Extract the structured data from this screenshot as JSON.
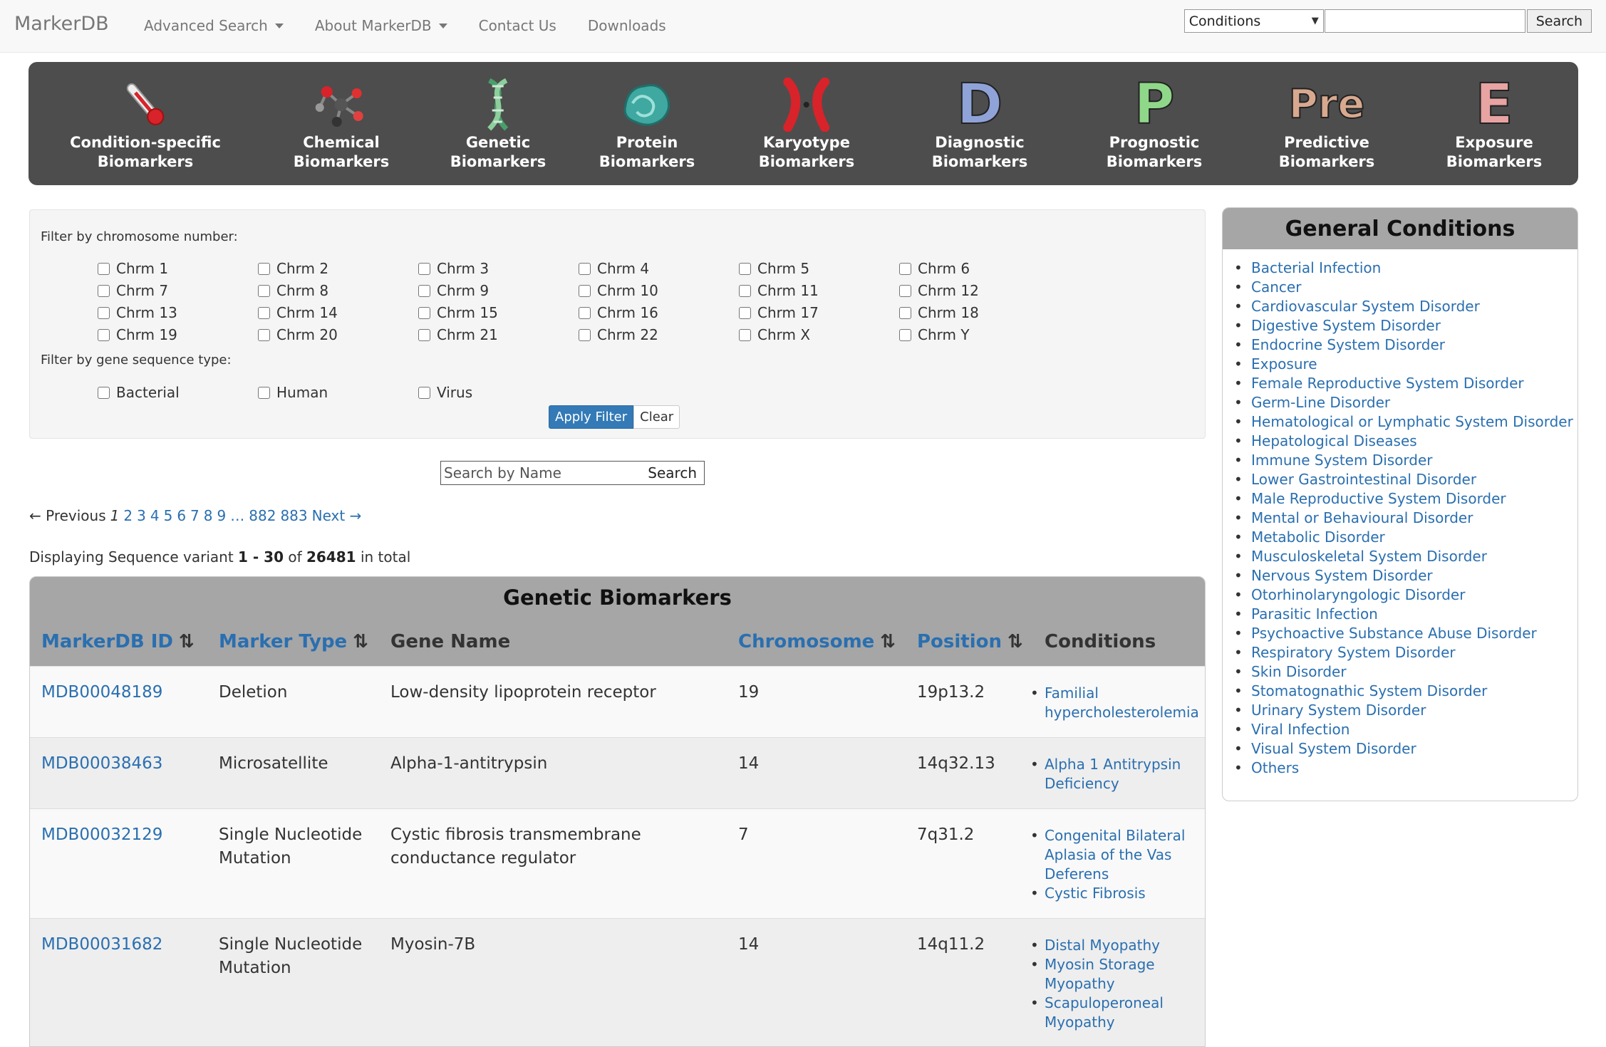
{
  "navbar": {
    "brand": "MarkerDB",
    "links": [
      "Advanced Search",
      "About MarkerDB",
      "Contact Us",
      "Downloads"
    ],
    "search_select": "Conditions",
    "search_button": "Search"
  },
  "banner": {
    "items": [
      {
        "line1": "Condition-specific",
        "line2": "Biomarkers",
        "icon": "thermometer-icon"
      },
      {
        "line1": "Chemical",
        "line2": "Biomarkers",
        "icon": "molecule-icon"
      },
      {
        "line1": "Genetic",
        "line2": "Biomarkers",
        "icon": "dna-icon"
      },
      {
        "line1": "Protein",
        "line2": "Biomarkers",
        "icon": "protein-icon"
      },
      {
        "line1": "Karyotype",
        "line2": "Biomarkers",
        "icon": "chromosome-icon"
      },
      {
        "line1": "Diagnostic",
        "line2": "Biomarkers",
        "icon": "letter-d-icon",
        "letter": "D"
      },
      {
        "line1": "Prognostic",
        "line2": "Biomarkers",
        "icon": "letter-p-icon",
        "letter": "P"
      },
      {
        "line1": "Predictive",
        "line2": "Biomarkers",
        "icon": "letter-pre-icon",
        "letter": "Pre"
      },
      {
        "line1": "Exposure",
        "line2": "Biomarkers",
        "icon": "letter-e-icon",
        "letter": "E"
      }
    ],
    "colors": {
      "diagnostic": "#8fa3d8",
      "prognostic": "#8fd889",
      "predictive": "#d8a98f",
      "exposure": "#e8a3a3"
    }
  },
  "filter": {
    "chromosome_label": "Filter by chromosome number:",
    "chromosomes": [
      "Chrm 1",
      "Chrm 2",
      "Chrm 3",
      "Chrm 4",
      "Chrm 5",
      "Chrm 6",
      "Chrm 7",
      "Chrm 8",
      "Chrm 9",
      "Chrm 10",
      "Chrm 11",
      "Chrm 12",
      "Chrm 13",
      "Chrm 14",
      "Chrm 15",
      "Chrm 16",
      "Chrm 17",
      "Chrm 18",
      "Chrm 19",
      "Chrm 20",
      "Chrm 21",
      "Chrm 22",
      "Chrm X",
      "Chrm Y"
    ],
    "sequence_label": "Filter by gene sequence type:",
    "sequence_types": [
      "Bacterial",
      "Human",
      "Virus"
    ],
    "apply_label": "Apply Filter",
    "clear_label": "Clear"
  },
  "search_by_name": {
    "placeholder": "Search by Name",
    "button": "Search"
  },
  "pagination": {
    "previous": "← Previous",
    "current": "1",
    "pages": [
      "2",
      "3",
      "4",
      "5",
      "6",
      "7",
      "8",
      "9"
    ],
    "ellipsis": "…",
    "last_pages": [
      "882",
      "883"
    ],
    "next": "Next →"
  },
  "display": {
    "prefix": "Displaying Sequence variant ",
    "range": "1 - 30",
    "of": " of ",
    "total": "26481",
    "suffix": " in total"
  },
  "table": {
    "title": "Genetic Biomarkers",
    "headers": [
      "MarkerDB ID",
      "Marker Type",
      "Gene Name",
      "Chromosome",
      "Position",
      "Conditions"
    ],
    "sort_icon": "⇅",
    "rows": [
      {
        "id": "MDB00048189",
        "type": [
          "Deletion"
        ],
        "gene": [
          "Low-density lipoprotein receptor"
        ],
        "chrom": "19",
        "pos": "19p13.2",
        "conditions": [
          [
            "Familial",
            "hypercholesterolemia"
          ]
        ]
      },
      {
        "id": "MDB00038463",
        "type": [
          "Microsatellite"
        ],
        "gene": [
          "Alpha-1-antitrypsin"
        ],
        "chrom": "14",
        "pos": "14q32.13",
        "conditions": [
          [
            "Alpha 1 Antitrypsin",
            "Deficiency"
          ]
        ]
      },
      {
        "id": "MDB00032129",
        "type": [
          "Single Nucleotide",
          "Mutation"
        ],
        "gene": [
          "Cystic fibrosis transmembrane",
          "conductance regulator"
        ],
        "chrom": "7",
        "pos": "7q31.2",
        "conditions": [
          [
            "Congenital Bilateral",
            "Aplasia of the Vas",
            "Deferens"
          ],
          [
            "Cystic Fibrosis"
          ]
        ]
      },
      {
        "id": "MDB00031682",
        "type": [
          "Single Nucleotide",
          "Mutation"
        ],
        "gene": [
          "Myosin-7B"
        ],
        "chrom": "14",
        "pos": "14q11.2",
        "conditions": [
          [
            "Distal Myopathy"
          ],
          [
            "Myosin Storage",
            "Myopathy"
          ],
          [
            "Scapuloperoneal",
            "Myopathy"
          ]
        ]
      }
    ]
  },
  "sidebar": {
    "title": "General Conditions",
    "items": [
      "Bacterial Infection",
      "Cancer",
      "Cardiovascular System Disorder",
      "Digestive System Disorder",
      "Endocrine System Disorder",
      "Exposure",
      "Female Reproductive System Disorder",
      "Germ-Line Disorder",
      "Hematological or Lymphatic System Disorder",
      "Hepatological Diseases",
      "Immune System Disorder",
      "Lower Gastrointestinal Disorder",
      "Male Reproductive System Disorder",
      "Mental or Behavioural Disorder",
      "Metabolic Disorder",
      "Musculoskeletal System Disorder",
      "Nervous System Disorder",
      "Otorhinolaryngologic Disorder",
      "Parasitic Infection",
      "Psychoactive Substance Abuse Disorder",
      "Respiratory System Disorder",
      "Skin Disorder",
      "Stomatognathic System Disorder",
      "Urinary System Disorder",
      "Viral Infection",
      "Visual System Disorder",
      "Others"
    ]
  }
}
